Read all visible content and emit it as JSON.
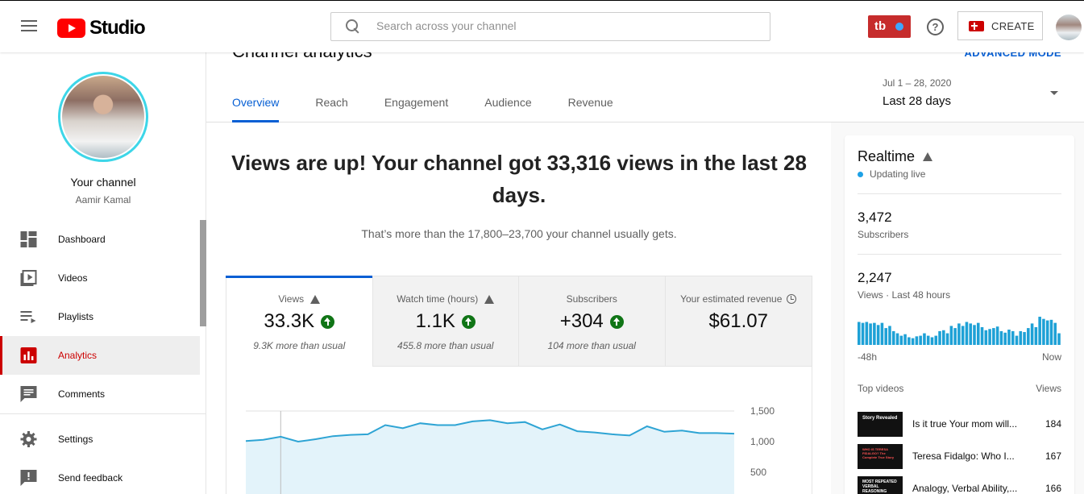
{
  "header": {
    "logo_text": "Studio",
    "search_placeholder": "Search across your channel",
    "badge_text": "tb",
    "help_glyph": "?",
    "create_label": "CREATE"
  },
  "sidebar": {
    "channel_title": "Your channel",
    "channel_name": "Aamir Kamal",
    "items": [
      {
        "label": "Dashboard",
        "icon": "dashboard-icon"
      },
      {
        "label": "Videos",
        "icon": "videos-icon"
      },
      {
        "label": "Playlists",
        "icon": "playlists-icon"
      },
      {
        "label": "Analytics",
        "icon": "analytics-icon",
        "active": true
      },
      {
        "label": "Comments",
        "icon": "comments-icon"
      }
    ],
    "lower_items": [
      {
        "label": "Settings",
        "icon": "settings-icon"
      },
      {
        "label": "Send feedback",
        "icon": "feedback-icon"
      }
    ]
  },
  "page": {
    "title": "Channel analytics",
    "advanced_mode": "ADVANCED MODE",
    "tabs": [
      "Overview",
      "Reach",
      "Engagement",
      "Audience",
      "Revenue"
    ],
    "active_tab": "Overview",
    "date_small": "Jul 1 – 28, 2020",
    "date_label": "Last 28 days"
  },
  "main": {
    "headline": "Views are up! Your channel got 33,316 views in the last 28 days.",
    "subline": "That’s more than the 17,800–23,700 your channel usually gets.",
    "metrics": [
      {
        "label": "Views",
        "value": "33.3K",
        "note": "9.3K more than usual",
        "icon": "warning-icon",
        "trend": "up"
      },
      {
        "label": "Watch time (hours)",
        "value": "1.1K",
        "note": "455.8 more than usual",
        "icon": "warning-icon",
        "trend": "up"
      },
      {
        "label": "Subscribers",
        "value": "+304",
        "note": "104 more than usual",
        "icon": "",
        "trend": "up"
      },
      {
        "label": "Your estimated revenue",
        "value": "$61.07",
        "note": "",
        "icon": "clock-icon",
        "trend": ""
      }
    ]
  },
  "chart_data": {
    "type": "area",
    "y_ticks": [
      "1,500",
      "1,000",
      "500"
    ],
    "ylim": [
      0,
      1500
    ],
    "series": [
      {
        "values": [
          1010,
          1030,
          1080,
          1000,
          1040,
          1090,
          1110,
          1120,
          1270,
          1220,
          1300,
          1270,
          1270,
          1330,
          1350,
          1300,
          1320,
          1200,
          1280,
          1170,
          1150,
          1120,
          1100,
          1250,
          1160,
          1180,
          1140,
          1140,
          1130
        ]
      }
    ],
    "color": "#2ea4d4",
    "fill": "#e3f3fa",
    "grid": true
  },
  "realtime": {
    "title": "Realtime",
    "live_label": "Updating live",
    "subscribers_value": "3,472",
    "subscribers_label": "Subscribers",
    "views_value": "2,247",
    "views_label": "Views · Last 48 hours",
    "axis_left": "-48h",
    "axis_right": "Now",
    "bars": [
      0.75,
      0.72,
      0.75,
      0.7,
      0.72,
      0.65,
      0.72,
      0.55,
      0.62,
      0.45,
      0.38,
      0.3,
      0.35,
      0.25,
      0.22,
      0.28,
      0.3,
      0.38,
      0.3,
      0.25,
      0.3,
      0.45,
      0.48,
      0.38,
      0.62,
      0.55,
      0.7,
      0.62,
      0.75,
      0.7,
      0.65,
      0.72,
      0.58,
      0.48,
      0.52,
      0.55,
      0.6,
      0.45,
      0.4,
      0.5,
      0.45,
      0.3,
      0.45,
      0.42,
      0.55,
      0.7,
      0.58,
      0.92,
      0.85,
      0.8,
      0.82,
      0.72,
      0.38
    ],
    "bar_color": "#1ea1d6",
    "top_videos_label": "Top videos",
    "views_col_label": "Views",
    "top_videos": [
      {
        "title": "Is it true Your mom will...",
        "views": "184",
        "thumb_text": "Story Revealed"
      },
      {
        "title": "Teresa Fidalgo: Who I...",
        "views": "167",
        "thumb_text": "WHO IS TERESA FIDALGO? The Complete True Story"
      },
      {
        "title": "Analogy, Verbal Ability,...",
        "views": "166",
        "thumb_text": "MOST REPEATED VERBAL REASONING"
      }
    ]
  }
}
